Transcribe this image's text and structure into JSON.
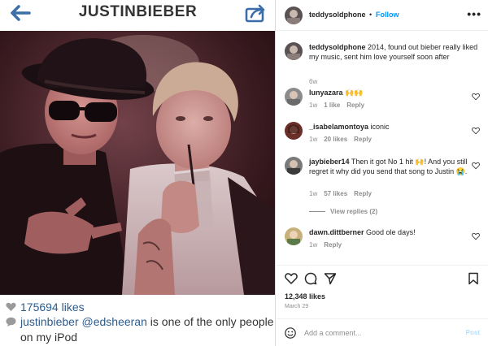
{
  "left_app": {
    "title": "JUSTINBIEBER",
    "likes": "175694 likes",
    "caption": {
      "user": "justinbieber",
      "mention": "@edsheeran",
      "text": " is one of the only people on my iPod"
    },
    "icons": {
      "back": "back-arrow-icon",
      "share": "share-icon",
      "heart": "heart-icon",
      "comment": "comment-bubble-icon"
    }
  },
  "post": {
    "header": {
      "username": "teddysoldphone",
      "dot": "•",
      "follow": "Follow",
      "more": "•••"
    },
    "caption": {
      "username": "teddysoldphone",
      "text": " 2014, found out bieber really liked my music, sent him love yourself soon after",
      "time": "6w"
    },
    "comments": [
      {
        "user": "lunyazara",
        "text": "🙌🙌",
        "time": "1w",
        "likes": "1 like",
        "reply": "Reply"
      },
      {
        "user": "_isabelamontoya",
        "text": "iconic",
        "time": "1w",
        "likes": "20 likes",
        "reply": "Reply"
      },
      {
        "user": "jaybieber14",
        "text": "Then it got No 1 hit 🙌! And you still regret it why did you send that song to Justin 😭.",
        "time": "1w",
        "likes": "57 likes",
        "reply": "Reply",
        "view_replies": "View replies (2)"
      },
      {
        "user": "dawn.dittberner",
        "text": "Good ole days!",
        "time": "1w",
        "reply": "Reply"
      }
    ],
    "likes_total": "12,348 likes",
    "date": "March 29",
    "add_comment": {
      "placeholder": "Add a comment...",
      "post": "Post"
    },
    "colors": {
      "follow": "#0095f6",
      "meta": "#8e8e8e",
      "link_old": "#2c5b8e",
      "post_disabled": "#b2dffc"
    }
  }
}
